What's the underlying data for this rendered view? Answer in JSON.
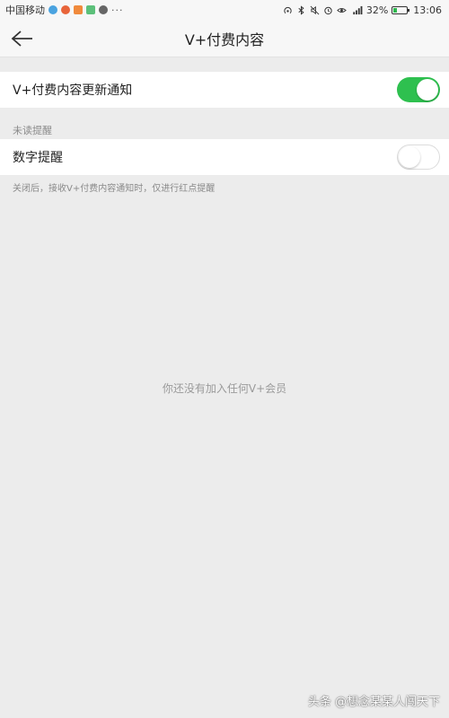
{
  "status_bar": {
    "carrier": "中国移动",
    "dots": "···",
    "battery_percent": "32%",
    "battery_level": 0.32,
    "time": "13:06",
    "icons": [
      "hotspot-icon",
      "bluetooth-icon",
      "mute-icon",
      "alarm-icon",
      "eye-icon",
      "signal-icon",
      "battery-icon"
    ]
  },
  "header": {
    "title": "V+付费内容",
    "back_icon": "arrow-left-icon"
  },
  "settings": {
    "update_notify_label": "V+付费内容更新通知",
    "update_notify_on": true,
    "section_unread": "未读提醒",
    "number_remind_label": "数字提醒",
    "number_remind_on": false,
    "helper": "关闭后，接收V+付费内容通知时，仅进行红点提醒"
  },
  "empty_state": "你还没有加入任何V+会员",
  "watermark": "头条 @想念某某人闯天下",
  "colors": {
    "toggle_on": "#2ec04f",
    "background": "#ececec",
    "panel": "#ffffff"
  }
}
